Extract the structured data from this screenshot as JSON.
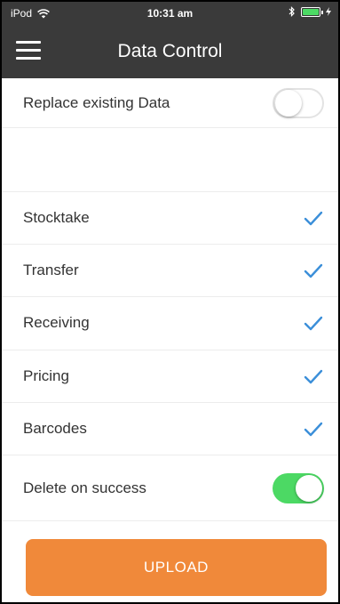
{
  "status_bar": {
    "carrier": "iPod",
    "time": "10:31 am",
    "battery_color": "#4cd964"
  },
  "nav": {
    "title": "Data Control",
    "menu_icon": "hamburger-menu-icon"
  },
  "settings": {
    "replace_existing": {
      "label": "Replace existing Data",
      "enabled": false
    },
    "delete_on_success": {
      "label": "Delete on success",
      "enabled": true
    }
  },
  "data_types": [
    {
      "label": "Stocktake",
      "checked": true
    },
    {
      "label": "Transfer",
      "checked": true
    },
    {
      "label": "Receiving",
      "checked": true
    },
    {
      "label": "Pricing",
      "checked": true
    },
    {
      "label": "Barcodes",
      "checked": true
    }
  ],
  "actions": {
    "upload_label": "UPLOAD"
  },
  "colors": {
    "header": "#3a3a3a",
    "accent_check": "#3b8fd9",
    "toggle_on": "#4cd964",
    "upload_button": "#f0893a"
  }
}
